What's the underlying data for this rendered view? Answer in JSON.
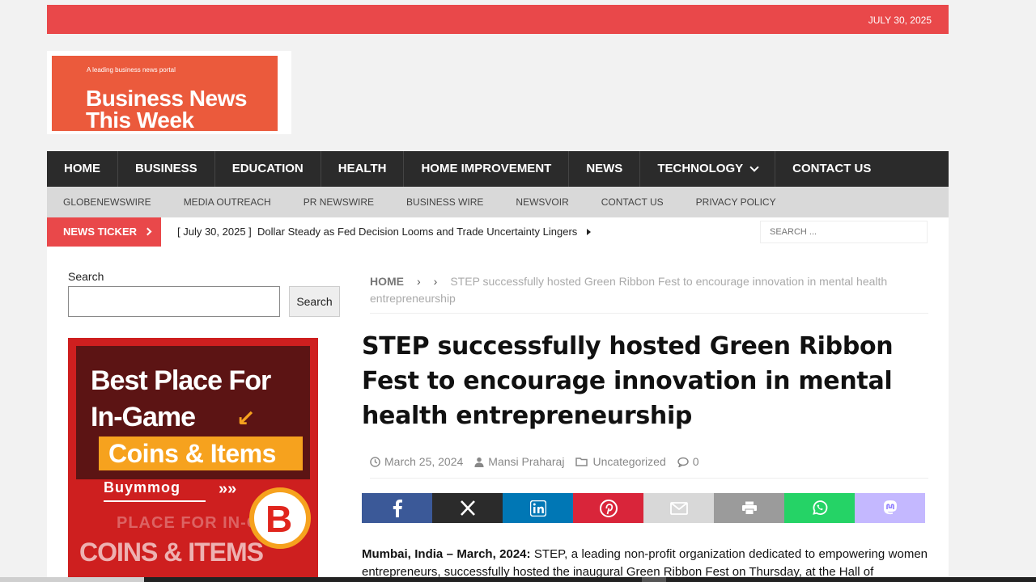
{
  "topbar": {
    "date": "July 30, 2025"
  },
  "logo": {
    "tagline": "A leading business news portal",
    "name_line1": "Business News",
    "name_line2": "This Week"
  },
  "main_nav": [
    "Home",
    "Business",
    "Education",
    "Health",
    "Home Improvement",
    "News",
    "Technology",
    "Contact Us"
  ],
  "sub_nav": [
    "Globenewswire",
    "Media Outreach",
    "PR Newswire",
    "Business Wire",
    "Newsvoir",
    "Contact Us",
    "Privacy Policy"
  ],
  "ticker": {
    "label": "News Ticker",
    "date": "[ July 30, 2025 ]",
    "headline": "Dollar Steady as Fed Decision Looms and Trade Uncertainty Lingers",
    "search_placeholder": "Search ..."
  },
  "sidebar": {
    "search_label": "Search",
    "search_button": "Search"
  },
  "ad": {
    "line1": "Best Place For",
    "line2": "In-Game",
    "line3": "Coins & Items",
    "brand": "Buymmog",
    "bg_text_small": "PLACE FOR IN-GA",
    "bg_text_large": "COINS & ITEMS"
  },
  "breadcrumb": {
    "home": "Home",
    "current": "STEP successfully hosted Green Ribbon Fest to encourage innovation in mental health entrepreneurship"
  },
  "article": {
    "title": "STEP successfully hosted Green Ribbon Fest to encourage innovation in mental health entrepreneurship",
    "date": "March 25, 2024",
    "author": "Mansi Praharaj",
    "category": "Uncategorized",
    "comments": "0",
    "lead": "Mumbai, India – March, 2024:",
    "body": " STEP, a leading non-profit organization dedicated to empowering women entrepreneurs, successfully hosted the inaugural Green Ribbon Fest on Thursday, at the Hall of"
  },
  "share_colors": {
    "facebook": "#3b5998",
    "x": "#2b2b2b",
    "linkedin": "#0077b5",
    "pinterest": "#d9253a",
    "email": "#d8d8d8",
    "print": "#9b9b9b",
    "whatsapp": "#25d366",
    "mastodon": "#6364ff"
  }
}
